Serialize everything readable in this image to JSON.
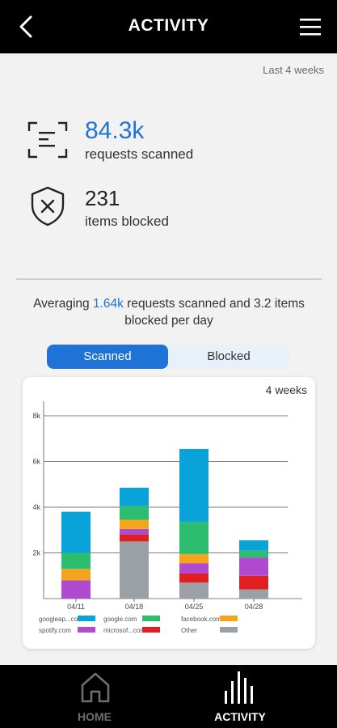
{
  "header": {
    "title": "ACTIVITY"
  },
  "period_label": "Last 4 weeks",
  "stats": {
    "scanned_value": "84.3k",
    "scanned_label": "requests scanned",
    "blocked_value": "231",
    "blocked_label": "items blocked"
  },
  "summary": {
    "prefix": "Averaging ",
    "highlight": "1.64k",
    "suffix": " requests scanned and 3.2 items blocked per day"
  },
  "toggle": {
    "scanned": "Scanned",
    "blocked": "Blocked",
    "selected": "Scanned"
  },
  "chart_card": {
    "range_label": "4 weeks"
  },
  "chart_data": {
    "type": "bar",
    "stacked": true,
    "categories": [
      "04/11",
      "04/18",
      "04/25",
      "04/28"
    ],
    "ylim": [
      0,
      8000
    ],
    "yticks": [
      "2k",
      "4k",
      "6k",
      "8k"
    ],
    "ytick_values": [
      2000,
      4000,
      6000,
      8000
    ],
    "series": [
      {
        "name": "Other",
        "color": "#9aa0a6",
        "values": [
          0,
          2500,
          700,
          400
        ]
      },
      {
        "name": "microsof...com",
        "color": "#e02020",
        "values": [
          0,
          300,
          400,
          600
        ]
      },
      {
        "name": "spotify.com",
        "color": "#b04ad0",
        "values": [
          800,
          250,
          450,
          800
        ]
      },
      {
        "name": "facebook.com",
        "color": "#f5a51b",
        "values": [
          500,
          400,
          400,
          0
        ]
      },
      {
        "name": "google.com",
        "color": "#2dbd6e",
        "values": [
          700,
          600,
          1400,
          300
        ]
      },
      {
        "name": "googleap...com",
        "color": "#0aa3d9",
        "values": [
          1800,
          800,
          3200,
          450
        ]
      }
    ],
    "legend_order": [
      "googleap...com",
      "google.com",
      "facebook.com",
      "spotify.com",
      "microsof...com",
      "Other"
    ],
    "grid": true
  },
  "nav": {
    "home": "HOME",
    "activity": "ACTIVITY",
    "active": "activity"
  }
}
